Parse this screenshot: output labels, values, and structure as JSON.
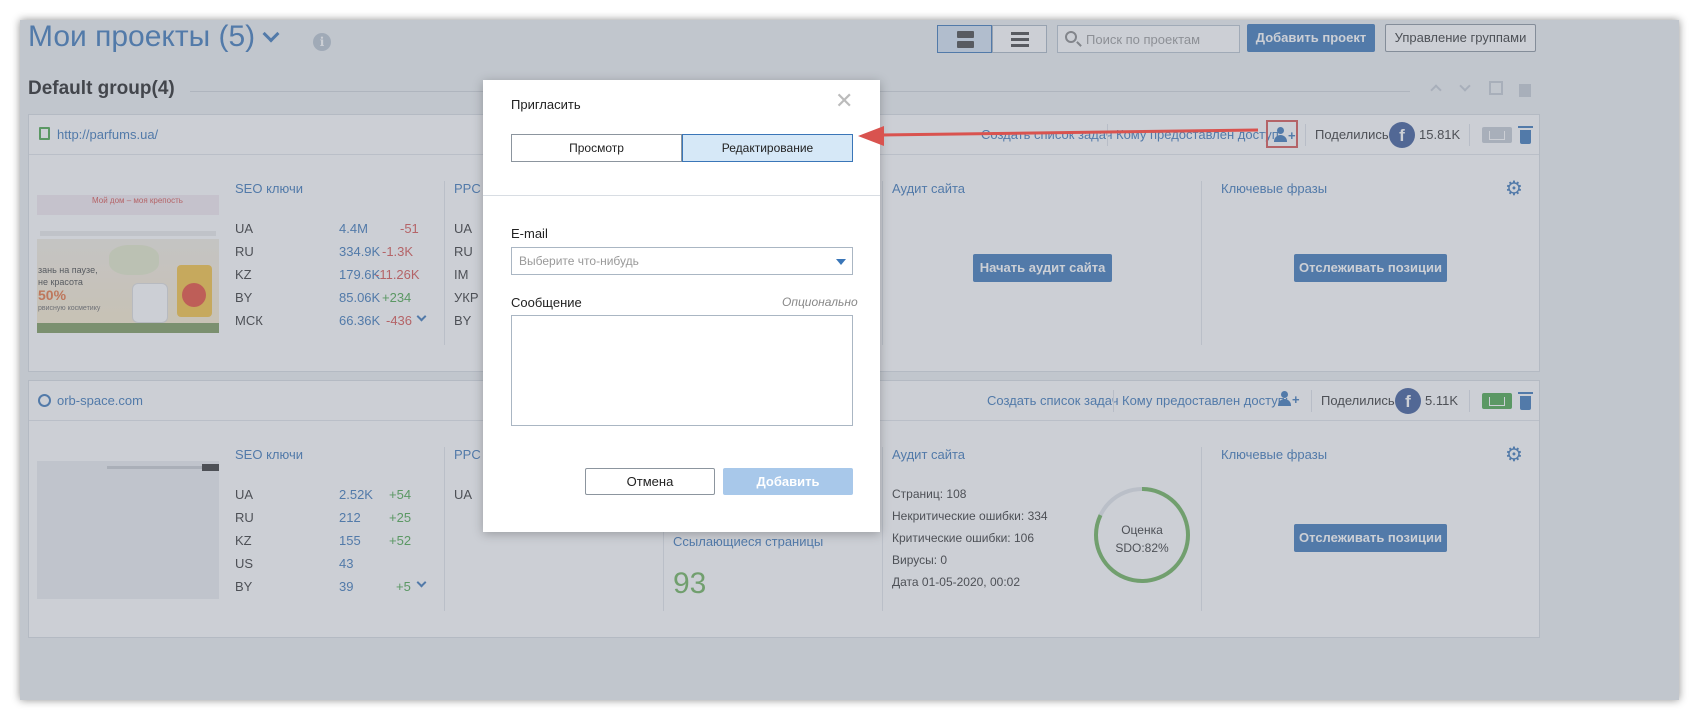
{
  "header": {
    "title": "Мои проекты (5)",
    "search_placeholder": "Поиск по проектам",
    "add_project": "Добавить проект",
    "manage_groups": "Управление группами"
  },
  "group": {
    "title": "Default group(4)"
  },
  "project1": {
    "url": "http://parfums.ua/",
    "create_tasks": "Создать список задач",
    "access": "Кому предоставлен доступ:",
    "shared": "Поделились:",
    "fb_count": "15.81K",
    "seo_title": "SEO ключи",
    "ppc_title": "PPC к",
    "audit_title": "Аудит сайта",
    "phrases_title": "Ключевые фразы",
    "seo_rows": [
      {
        "label": "UA",
        "value": "4.4M",
        "delta": "-51"
      },
      {
        "label": "RU",
        "value": "334.9K",
        "delta": "-1.3K"
      },
      {
        "label": "KZ",
        "value": "179.6K",
        "delta": "-11.26K"
      },
      {
        "label": "BY",
        "value": "85.06K",
        "delta": "+234"
      },
      {
        "label": "МСК",
        "value": "66.36K",
        "delta": "-436"
      }
    ],
    "ppc_rows": [
      "UA",
      "RU",
      "IM",
      "УКР",
      "BY"
    ],
    "audit_button": "Начать аудит сайта",
    "track_button": "Отслеживать позиции",
    "thumb_text": {
      "l1": "Мой дом – моя крепость",
      "l2": "зань на паузе,",
      "l3": "не красота",
      "l4": "50%",
      "l5": "рвисную косметику"
    }
  },
  "project2": {
    "url": "orb-space.com",
    "create_tasks": "Создать список задач",
    "access": "Кому предоставлен доступ:",
    "shared": "Поделились:",
    "fb_count": "5.11K",
    "seo_title": "SEO ключи",
    "ppc_title": "PPC к",
    "audit_title": "Аудит сайта",
    "phrases_title": "Ключевые фразы",
    "seo_rows": [
      {
        "label": "UA",
        "value": "2.52K",
        "delta": "+54"
      },
      {
        "label": "RU",
        "value": "212",
        "delta": "+25"
      },
      {
        "label": "KZ",
        "value": "155",
        "delta": "+52"
      },
      {
        "label": "US",
        "value": "43",
        "delta": ""
      },
      {
        "label": "BY",
        "value": "39",
        "delta": "+5"
      }
    ],
    "ppc_rows": [
      "UA"
    ],
    "backlinks_title": "Ссылающиеся страницы",
    "backlinks_value": "93",
    "audit_pages_label": "Страниц:",
    "audit_pages": "108",
    "audit_noncrit_label": "Некритические ошибки:",
    "audit_noncrit": "334",
    "audit_crit_label": "Критические ошибки:",
    "audit_crit": "106",
    "audit_viruses_label": "Вирусы:",
    "audit_viruses": "0",
    "audit_date_label": "Дата",
    "audit_date": "01-05-2020, 00:02",
    "score_label": "Оценка",
    "score_value": "SDO:82%",
    "score_fraction": 0.82,
    "track_button": "Отслеживать позиции"
  },
  "modal": {
    "title": "Пригласить",
    "tab_view": "Просмотр",
    "tab_edit": "Редактирование",
    "email_label": "E-mail",
    "email_placeholder": "Выберите что-нибудь",
    "message_label": "Сообщение",
    "optional": "Опционально",
    "cancel": "Отмена",
    "add": "Добавить"
  },
  "colors": {
    "accent": "#3a76b8",
    "positive": "#4aa64a",
    "negative": "#d9534f",
    "annotation": "#d9534f",
    "facebook": "#3b5998"
  }
}
